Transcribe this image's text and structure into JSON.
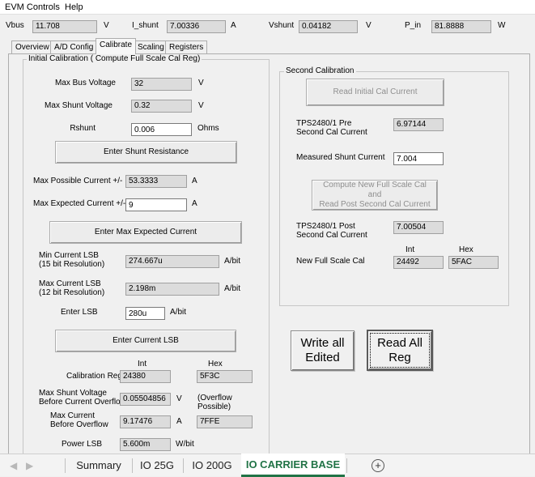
{
  "menu": {
    "evm_controls": "EVM Controls",
    "help": "Help"
  },
  "status": {
    "vbus": {
      "label": "Vbus",
      "value": "11.708",
      "unit": "V"
    },
    "ishunt": {
      "label": "I_shunt",
      "value": "7.00336",
      "unit": "A"
    },
    "vshunt": {
      "label": "Vshunt",
      "value": "0.04182",
      "unit": "V"
    },
    "pin": {
      "label": "P_in",
      "value": "81.8888",
      "unit": "W"
    }
  },
  "tabs": [
    "Overview",
    "A/D Config",
    "Calibrate",
    "Scaling",
    "Registers"
  ],
  "initial": {
    "title": "Initial Calibration ( Compute Full Scale Cal Reg)",
    "max_bus_voltage": {
      "label": "Max Bus Voltage",
      "value": "32",
      "unit": "V"
    },
    "max_shunt_voltage": {
      "label": "Max Shunt Voltage",
      "value": "0.32",
      "unit": "V"
    },
    "rshunt": {
      "label": "Rshunt",
      "value": "0.006",
      "unit": "Ohms"
    },
    "enter_shunt_button": "Enter Shunt Resistance",
    "max_possible_current": {
      "label": "Max Possible Current +/-",
      "value": "53.3333",
      "unit": "A"
    },
    "max_expected_current": {
      "label": "Max Expected Current +/-",
      "value": "9",
      "unit": "A"
    },
    "enter_max_expected_button": "Enter Max Expected Current",
    "min_current_lsb": {
      "label1": "Min Current LSB",
      "label2": "(15 bit Resolution)",
      "value": "274.667u",
      "unit": "A/bit"
    },
    "max_current_lsb": {
      "label1": "Max Current LSB",
      "label2": "(12 bit Resolution)",
      "value": "2.198m",
      "unit": "A/bit"
    },
    "enter_lsb": {
      "label": "Enter LSB",
      "value": "280u",
      "unit": "A/bit"
    },
    "enter_current_lsb_button": "Enter Current LSB",
    "col_int": "Int",
    "col_hex": "Hex",
    "calibration_reg": {
      "label": "Calibration Reg",
      "int": "24380",
      "hex": "5F3C"
    },
    "max_shunt_before_overflow": {
      "label1": "Max Shunt Voltage",
      "label2": "Before Current Overflow",
      "value": "0.05504856",
      "unit": "V",
      "note1": "(Overflow",
      "note2": "Possible)"
    },
    "max_current_before_overflow": {
      "label1": "Max Current",
      "label2": "Before Overflow",
      "value": "9.17476",
      "unit": "A",
      "hex": "7FFE"
    },
    "power_lsb": {
      "label": "Power LSB",
      "value": "5.600m",
      "unit": "W/bit"
    }
  },
  "second": {
    "title": "Second Calibration",
    "read_initial_button": "Read Initial Cal Current",
    "pre_current": {
      "label1": "TPS2480/1 Pre",
      "label2": "Second Cal Current",
      "value": "6.97144"
    },
    "measured_shunt_current": {
      "label": "Measured Shunt Current",
      "value": "7.004"
    },
    "compute_button_line1": "Compute New Full Scale Cal and",
    "compute_button_line2": "Read Post Second Cal Current",
    "post_current": {
      "label1": "TPS2480/1 Post",
      "label2": "Second Cal Current",
      "value": "7.00504"
    },
    "col_int": "Int",
    "col_hex": "Hex",
    "new_full_scale": {
      "label": "New Full Scale Cal",
      "int": "24492",
      "hex": "5FAC"
    }
  },
  "actions": {
    "write_all_line1": "Write all",
    "write_all_line2": "Edited",
    "read_all_line1": "Read All",
    "read_all_line2": "Reg"
  },
  "sheets": {
    "tabs": [
      "Summary",
      "IO 25G",
      "IO 200G",
      "IO CARRIER BASE"
    ],
    "active": "IO CARRIER BASE",
    "active_color": "#217346"
  }
}
